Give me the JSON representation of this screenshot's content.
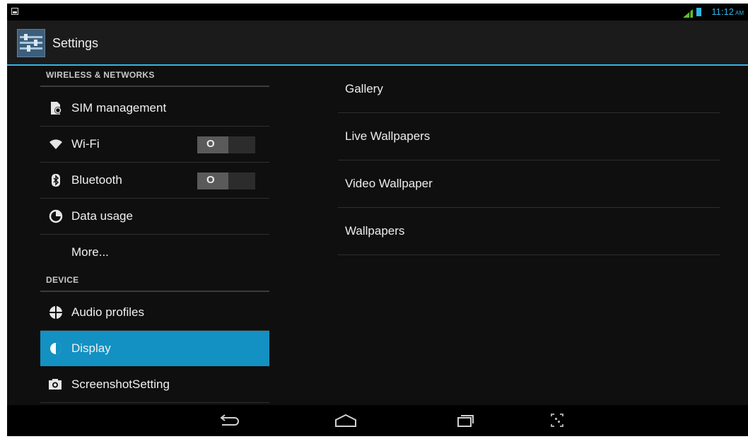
{
  "status_bar": {
    "time": "11:12",
    "ampm": "AM",
    "icons": [
      "screenshot-notification-icon",
      "signal-icon",
      "battery-icon"
    ]
  },
  "action_bar": {
    "title": "Settings",
    "icon": "settings-app-icon"
  },
  "settings": {
    "sections": [
      {
        "header": "WIRELESS & NETWORKS"
      },
      {
        "header": "DEVICE"
      }
    ],
    "items": [
      {
        "label": "SIM management",
        "icon": "sim-card-icon"
      },
      {
        "label": "Wi-Fi",
        "icon": "wifi-icon",
        "toggle": "O",
        "on": false
      },
      {
        "label": "Bluetooth",
        "icon": "bluetooth-icon",
        "toggle": "O",
        "on": false
      },
      {
        "label": "Data usage",
        "icon": "data-usage-icon"
      },
      {
        "label": "More..."
      },
      {
        "label": "Audio profiles",
        "icon": "audio-profiles-icon"
      },
      {
        "label": "Display",
        "icon": "display-icon",
        "selected": true
      },
      {
        "label": "ScreenshotSetting",
        "icon": "camera-icon"
      }
    ]
  },
  "wallpaper_sources": {
    "items": [
      {
        "label": "Gallery"
      },
      {
        "label": "Live Wallpapers"
      },
      {
        "label": "Video Wallpaper"
      },
      {
        "label": "Wallpapers"
      }
    ]
  },
  "nav_bar": {
    "buttons": [
      "back-icon",
      "home-icon",
      "recent-apps-icon",
      "screenshot-icon"
    ]
  },
  "colors": {
    "accent": "#33b5e5",
    "selected": "#1391c2",
    "background": "#0f0f0f"
  }
}
